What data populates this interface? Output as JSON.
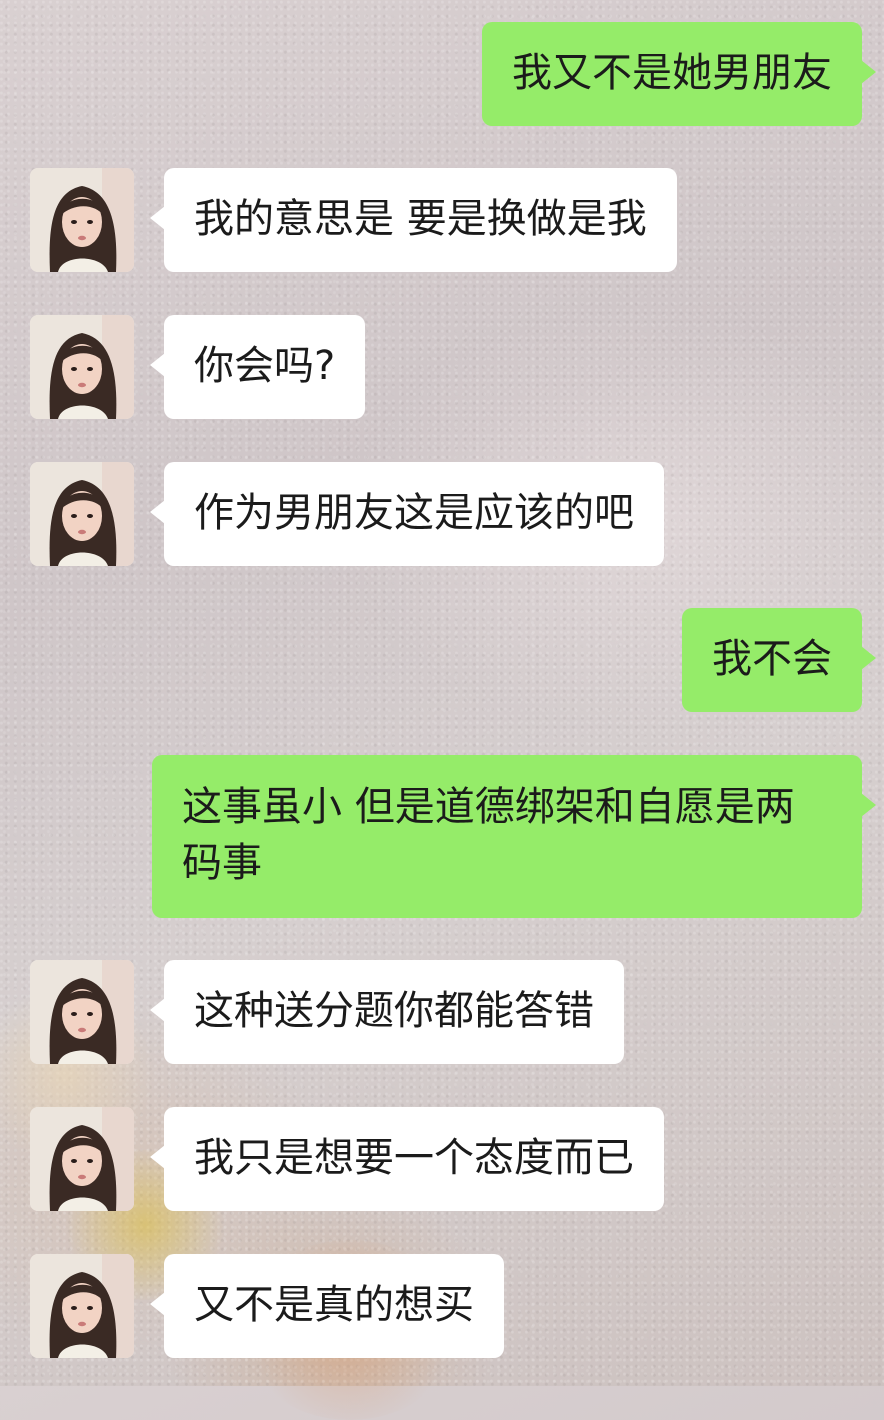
{
  "chat": {
    "messages": [
      {
        "sender": "self",
        "text": "我又不是她男朋友"
      },
      {
        "sender": "contact",
        "text": "我的意思是 要是换做是我"
      },
      {
        "sender": "contact",
        "text": "你会吗?"
      },
      {
        "sender": "contact",
        "text": "作为男朋友这是应该的吧"
      },
      {
        "sender": "self",
        "text": "我不会"
      },
      {
        "sender": "self",
        "text": "这事虽小 但是道德绑架和自愿是两码事"
      },
      {
        "sender": "contact",
        "text": "这种送分题你都能答错"
      },
      {
        "sender": "contact",
        "text": "我只是想要一个态度而已"
      },
      {
        "sender": "contact",
        "text": "又不是真的想买"
      }
    ]
  },
  "colors": {
    "outgoing_bubble": "#95ec69",
    "incoming_bubble": "#ffffff",
    "text": "#1b1b1b"
  }
}
